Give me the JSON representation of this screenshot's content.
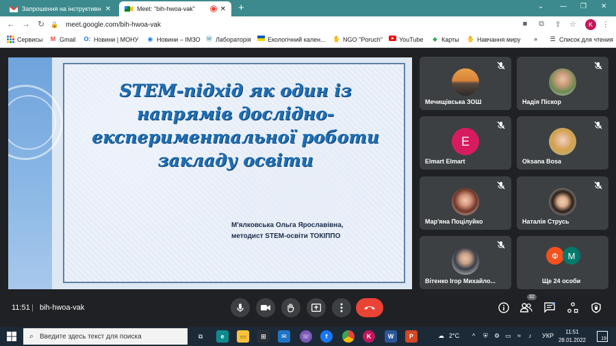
{
  "tabs": [
    {
      "title": "Запрошення на інструктивно-м",
      "favicon": "gmail-icon",
      "close": "✕"
    },
    {
      "title": "Meet: \"bih-hwoa-vak\"",
      "favicon": "meet-icon",
      "close": "✕"
    }
  ],
  "new_tab": "+",
  "address": {
    "url": "meet.google.com/bih-hwoa-vak"
  },
  "profile_initial": "K",
  "bookmarks": [
    {
      "label": "Сервисы",
      "icon": "apps-grid-icon"
    },
    {
      "label": "Gmail",
      "icon": "gmail-icon"
    },
    {
      "label": "Новини | МОНУ",
      "icon": "mon-icon"
    },
    {
      "label": "Новини – ІМЗО",
      "icon": "globe-icon"
    },
    {
      "label": "Лабораторія",
      "icon": "wordpress-icon"
    },
    {
      "label": "Екологічний кален...",
      "icon": "ukraine-flag-icon"
    },
    {
      "label": "NGO \"Poruch\"",
      "icon": "hand-icon"
    },
    {
      "label": "YouTube",
      "icon": "youtube-icon"
    },
    {
      "label": "Карты",
      "icon": "maps-icon"
    },
    {
      "label": "Навчання миру",
      "icon": "hand-icon"
    }
  ],
  "bookmarks_more": "»",
  "reading_list": "Список для чтения",
  "slide": {
    "title": "STEM-підхід як один із напрямів дослідно-експериментальної роботи закладу освіти",
    "author_line1": "М'ялковська Ольга Ярославівна,",
    "author_line2": "методист STEM-освіти ТОКІППО"
  },
  "participants": [
    {
      "name": "Мечищівська ЗОШ",
      "avatar": "photo"
    },
    {
      "name": "Надія Піскор",
      "avatar": "photo"
    },
    {
      "name": "Elmart Elmart",
      "avatar": "letter",
      "letter": "E"
    },
    {
      "name": "Oksana Bosa",
      "avatar": "photo"
    },
    {
      "name": "Мар'яна Поцілуйко",
      "avatar": "photo"
    },
    {
      "name": "Наталія Струсь",
      "avatar": "photo"
    },
    {
      "name": "Вітенко Ігор Михайло...",
      "avatar": "photo"
    }
  ],
  "others": {
    "label": "Ще 24 особи",
    "avatars": [
      {
        "letter": "Ф",
        "color": "#f4511e"
      },
      {
        "letter": "M",
        "color": "#00796b"
      }
    ]
  },
  "meeting": {
    "time": "11:51",
    "separator": "|",
    "code": "bih-hwoa-vak",
    "people_count": "32"
  },
  "taskbar": {
    "search_placeholder": "Введите здесь текст для поиска",
    "weather": "2°C",
    "language": "УКР",
    "clock_time": "11:51",
    "clock_date": "28.01.2022",
    "notifications": "19"
  },
  "colors": {
    "tabbar": "#3c8a8d",
    "meet_bg": "#202124",
    "tile_bg": "#3c4043",
    "end_call": "#ea4335",
    "slide_title": "#1f6fb5"
  }
}
